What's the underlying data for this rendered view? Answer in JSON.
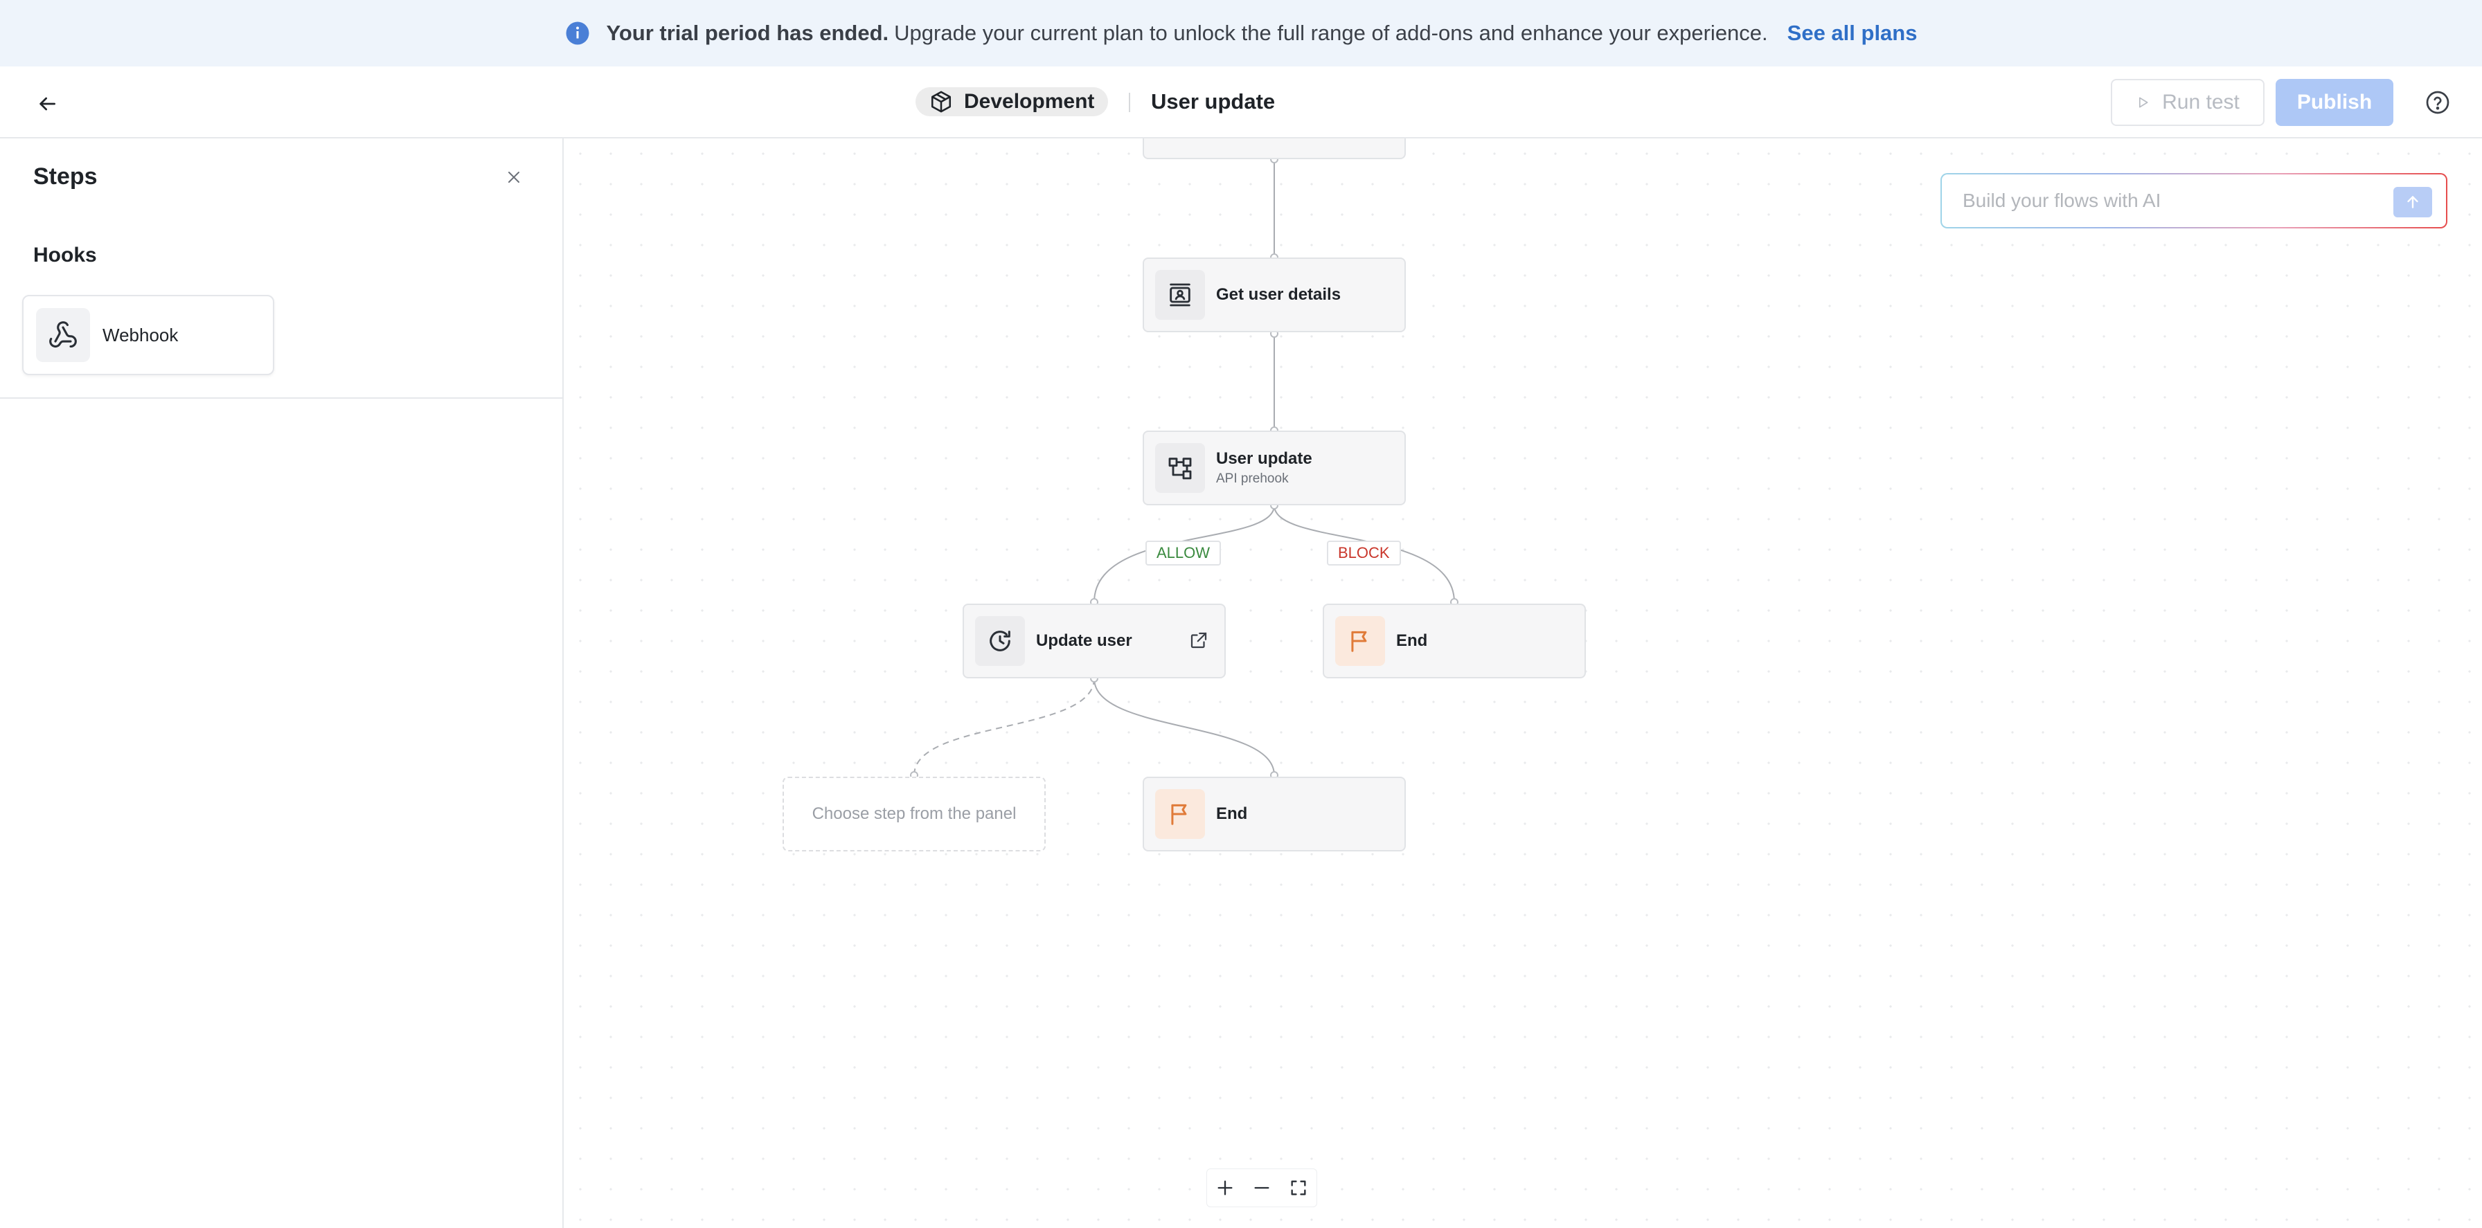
{
  "banner": {
    "icon": "info-icon",
    "bold_text": "Your trial period has ended.",
    "text": "Upgrade your current plan to unlock the full range of add-ons and enhance your experience.",
    "link_label": "See all plans"
  },
  "header": {
    "back_icon": "arrow-left-icon",
    "environment": "Development",
    "flow_title": "User update",
    "run_test_label": "Run test",
    "publish_label": "Publish",
    "help_icon": "help-circle-icon"
  },
  "panel": {
    "title": "Steps",
    "section_title": "Hooks",
    "items": [
      {
        "label": "Webhook",
        "icon": "webhook-icon"
      }
    ]
  },
  "flow": {
    "nodes": {
      "get_user": {
        "title": "Get user details",
        "icon": "contact-card-icon"
      },
      "user_update": {
        "title": "User update",
        "subtitle": "API prehook",
        "icon": "workflow-icon"
      },
      "update_user": {
        "title": "Update user",
        "icon": "refresh-clock-icon"
      },
      "end_block": {
        "title": "End",
        "icon": "flag-icon"
      },
      "end_allow": {
        "title": "End",
        "icon": "flag-icon"
      },
      "placeholder": {
        "title": "Choose step from the panel"
      }
    },
    "branches": {
      "allow": "ALLOW",
      "block": "BLOCK"
    }
  },
  "ai": {
    "placeholder": "Build your flows with AI"
  },
  "colors": {
    "accent": "#2f6fc7",
    "publish_bg": "#aec8f6",
    "allow": "#3a8a3f",
    "block": "#c9362b",
    "end_icon": "#e07b39"
  }
}
